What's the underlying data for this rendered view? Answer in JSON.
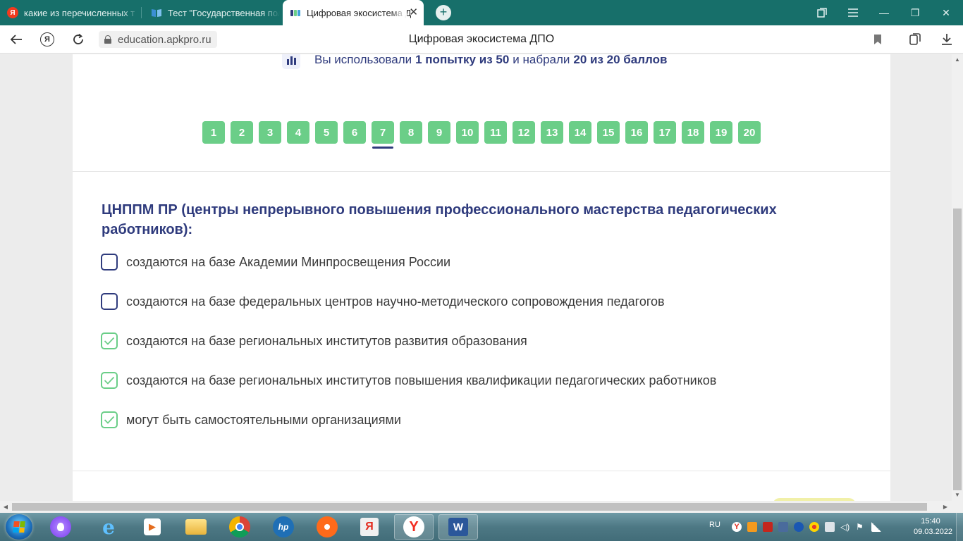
{
  "browser": {
    "tabs": [
      {
        "label": "какие из перечисленных т",
        "icon": "yandex-icon"
      },
      {
        "label": "Тест \"Государственная пол",
        "icon": "book-icon"
      },
      {
        "label": "Цифровая экосистема Д",
        "icon": "ecosystem-icon",
        "close": "✕"
      }
    ],
    "new_tab": "+",
    "url": "education.apkpro.ru",
    "page_title": "Цифровая экосистема ДПО",
    "window_controls": {
      "minimize": "—",
      "restore": "❐",
      "close": "✕"
    }
  },
  "quiz": {
    "attempts": {
      "prefix": "Вы использовали",
      "used": "1 попытку из 50",
      "middle": "и набрали",
      "score": "20 из 20 баллов"
    },
    "question_numbers": [
      "1",
      "2",
      "3",
      "4",
      "5",
      "6",
      "7",
      "8",
      "9",
      "10",
      "11",
      "12",
      "13",
      "14",
      "15",
      "16",
      "17",
      "18",
      "19",
      "20"
    ],
    "active_question": "7",
    "question": "ЦНППМ ПР (центры непрерывного повышения профессионального мастерства педагогических работников):",
    "options": [
      {
        "text": "создаются на базе Академии Минпросвещения России",
        "checked": false
      },
      {
        "text": "создаются на базе федеральных центров научно-методического сопровождения педагогов",
        "checked": false
      },
      {
        "text": "создаются на базе региональных институтов развития образования",
        "checked": true
      },
      {
        "text": "создаются на базе региональных институтов повышения квалификации педагогических работников",
        "checked": true
      },
      {
        "text": "могут быть самостоятельными организациями",
        "checked": true
      }
    ]
  },
  "taskbar": {
    "language": "RU",
    "time": "15:40",
    "date": "09.03.2022"
  },
  "colors": {
    "tabbar": "#176f6a",
    "accent_green": "#6bce88",
    "navy": "#2f3b7d"
  }
}
